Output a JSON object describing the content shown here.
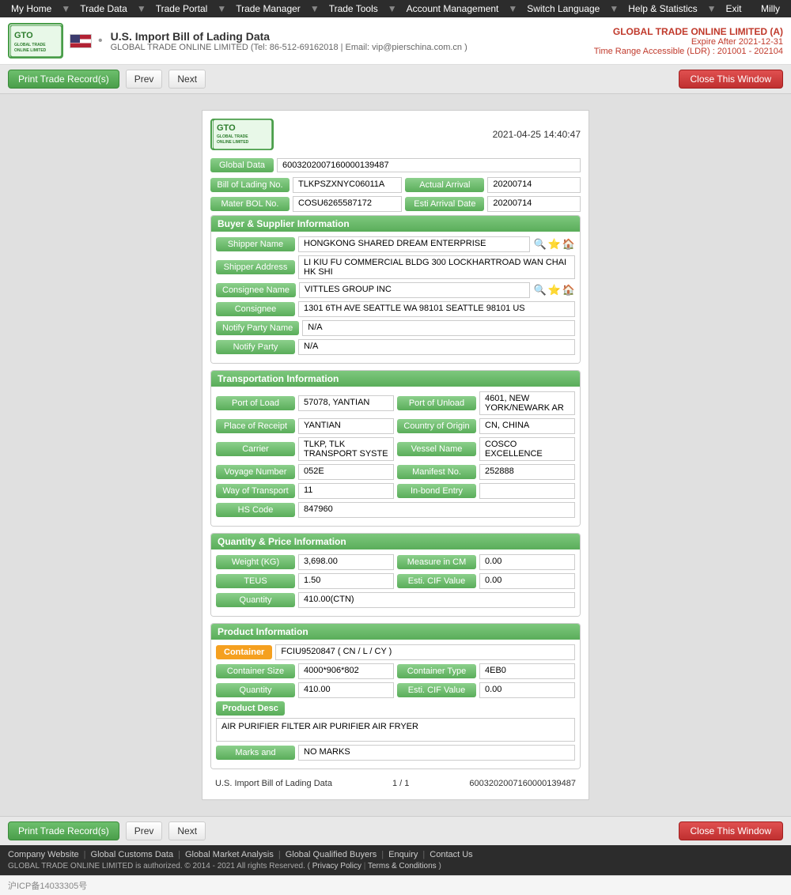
{
  "nav": {
    "items": [
      "My Home",
      "Trade Data",
      "Trade Portal",
      "Trade Manager",
      "Trade Tools",
      "Account Management",
      "Switch Language",
      "Help & Statistics",
      "Exit"
    ],
    "user": "Milly"
  },
  "header": {
    "title": "U.S. Import Bill of Lading Data",
    "subtitle": "GLOBAL TRADE ONLINE LIMITED (Tel: 86-512-69162018 | Email: vip@pierschina.com.cn )",
    "company": "GLOBAL TRADE ONLINE LIMITED (A)",
    "expire": "Expire After 2021-12-31",
    "time_range": "Time Range Accessible (LDR) : 201001 - 202104"
  },
  "toolbar": {
    "print_label": "Print Trade Record(s)",
    "prev_label": "Prev",
    "next_label": "Next",
    "close_label": "Close This Window"
  },
  "record": {
    "timestamp": "2021-04-25 14:40:47",
    "global_data_label": "Global Data",
    "global_data_value": "6003202007160000139487",
    "bol_no_label": "Bill of Lading No.",
    "bol_no_value": "TLKPSZXNYC06011A",
    "actual_arrival_label": "Actual Arrival",
    "actual_arrival_value": "20200714",
    "master_bol_label": "Mater BOL No.",
    "master_bol_value": "COSU6265587172",
    "esti_arrival_label": "Esti Arrival Date",
    "esti_arrival_value": "20200714"
  },
  "buyer_supplier": {
    "section_title": "Buyer & Supplier Information",
    "shipper_name_label": "Shipper Name",
    "shipper_name_value": "HONGKONG SHARED DREAM ENTERPRISE",
    "shipper_address_label": "Shipper Address",
    "shipper_address_value": "LI KIU FU COMMERCIAL BLDG 300 LOCKHARTROAD WAN CHAI HK SHI",
    "consignee_name_label": "Consignee Name",
    "consignee_name_value": "VITTLES GROUP INC",
    "consignee_label": "Consignee",
    "consignee_value": "1301 6TH AVE SEATTLE WA 98101 SEATTLE 98101 US",
    "notify_party_name_label": "Notify Party Name",
    "notify_party_name_value": "N/A",
    "notify_party_label": "Notify Party",
    "notify_party_value": "N/A"
  },
  "transportation": {
    "section_title": "Transportation Information",
    "port_of_load_label": "Port of Load",
    "port_of_load_value": "57078, YANTIAN",
    "port_of_unload_label": "Port of Unload",
    "port_of_unload_value": "4601, NEW YORK/NEWARK AR",
    "place_of_receipt_label": "Place of Receipt",
    "place_of_receipt_value": "YANTIAN",
    "country_of_origin_label": "Country of Origin",
    "country_of_origin_value": "CN, CHINA",
    "carrier_label": "Carrier",
    "carrier_value": "TLKP, TLK TRANSPORT SYSTE",
    "vessel_name_label": "Vessel Name",
    "vessel_name_value": "COSCO EXCELLENCE",
    "voyage_number_label": "Voyage Number",
    "voyage_number_value": "052E",
    "manifest_no_label": "Manifest No.",
    "manifest_no_value": "252888",
    "way_of_transport_label": "Way of Transport",
    "way_of_transport_value": "11",
    "in_bond_entry_label": "In-bond Entry",
    "in_bond_entry_value": "",
    "hs_code_label": "HS Code",
    "hs_code_value": "847960"
  },
  "quantity_price": {
    "section_title": "Quantity & Price Information",
    "weight_label": "Weight (KG)",
    "weight_value": "3,698.00",
    "measure_in_cm_label": "Measure in CM",
    "measure_in_cm_value": "0.00",
    "teus_label": "TEUS",
    "teus_value": "1.50",
    "esti_cif_value_label": "Esti. CIF Value",
    "esti_cif_value_value": "0.00",
    "quantity_label": "Quantity",
    "quantity_value": "410.00(CTN)"
  },
  "product": {
    "section_title": "Product Information",
    "container_label": "Container",
    "container_value": "FCIU9520847 ( CN / L / CY )",
    "container_size_label": "Container Size",
    "container_size_value": "4000*906*802",
    "container_type_label": "Container Type",
    "container_type_value": "4EB0",
    "quantity_label": "Quantity",
    "quantity_value": "410.00",
    "esti_cif_label": "Esti. CIF Value",
    "esti_cif_value": "0.00",
    "product_desc_label": "Product Desc",
    "product_desc_value": "AIR PURIFIER FILTER AIR PURIFIER AIR FRYER",
    "marks_and_label": "Marks and",
    "marks_and_value": "NO MARKS"
  },
  "record_footer": {
    "source": "U.S. Import Bill of Lading Data",
    "page": "1 / 1",
    "record_id": "6003202007160000139487"
  },
  "footer": {
    "links": [
      "Company Website",
      "Global Customs Data",
      "Global Market Analysis",
      "Global Qualified Buyers",
      "Enquiry",
      "Contact Us"
    ],
    "copyright": "GLOBAL TRADE ONLINE LIMITED is authorized. © 2014 - 2021 All rights Reserved.",
    "privacy": "Privacy Policy",
    "terms": "Terms & Conditions",
    "icp": "沪ICP备14033305号"
  }
}
